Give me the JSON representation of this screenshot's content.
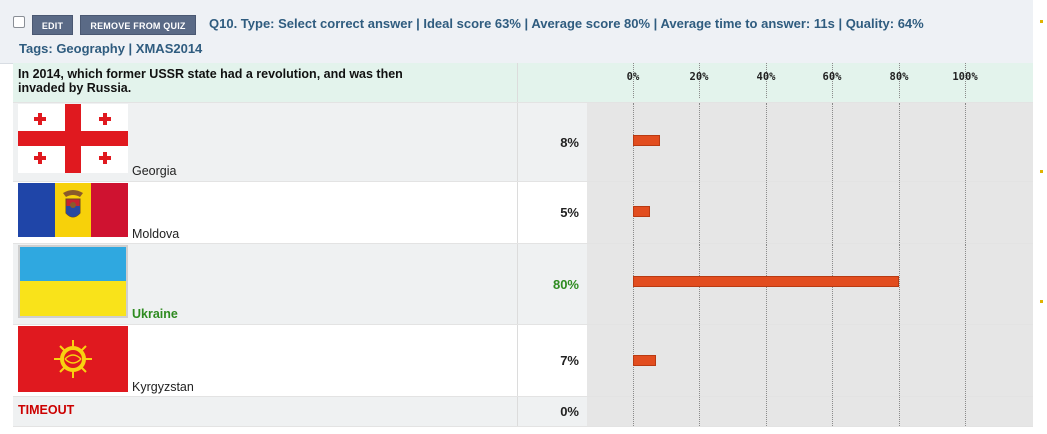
{
  "header": {
    "edit_label": "EDIT",
    "remove_label": "REMOVE FROM QUIZ",
    "question_info": "Q10. Type: Select correct answer | Ideal score 63% | Average score 80% | Average time to answer: 11s | Quality: 64%",
    "tags": "Tags: Geography | XMAS2014"
  },
  "question": {
    "text_line1": "In 2014, which former USSR state had a revolution, and was then",
    "text_line2": "invaded by Russia."
  },
  "axis": {
    "ticks": [
      "0%",
      "20%",
      "40%",
      "60%",
      "80%",
      "100%"
    ],
    "max": 100
  },
  "answers": [
    {
      "label": "Georgia",
      "percent_text": "8%",
      "value": 8,
      "correct": false,
      "flag": "georgia-flag"
    },
    {
      "label": "Moldova",
      "percent_text": "5%",
      "value": 5,
      "correct": false,
      "flag": "moldova-flag"
    },
    {
      "label": "Ukraine",
      "percent_text": "80%",
      "value": 80,
      "correct": true,
      "flag": "ukraine-flag"
    },
    {
      "label": "Kyrgyzstan",
      "percent_text": "7%",
      "value": 7,
      "correct": false,
      "flag": "kyrgyzstan-flag"
    }
  ],
  "timeout": {
    "label": "TIMEOUT",
    "percent_text": "0%",
    "value": 0
  },
  "colors": {
    "bar": "#e24d1f",
    "correct": "#2e8b20",
    "timeout": "#cc0000",
    "header_text": "#2f5c7f"
  }
}
